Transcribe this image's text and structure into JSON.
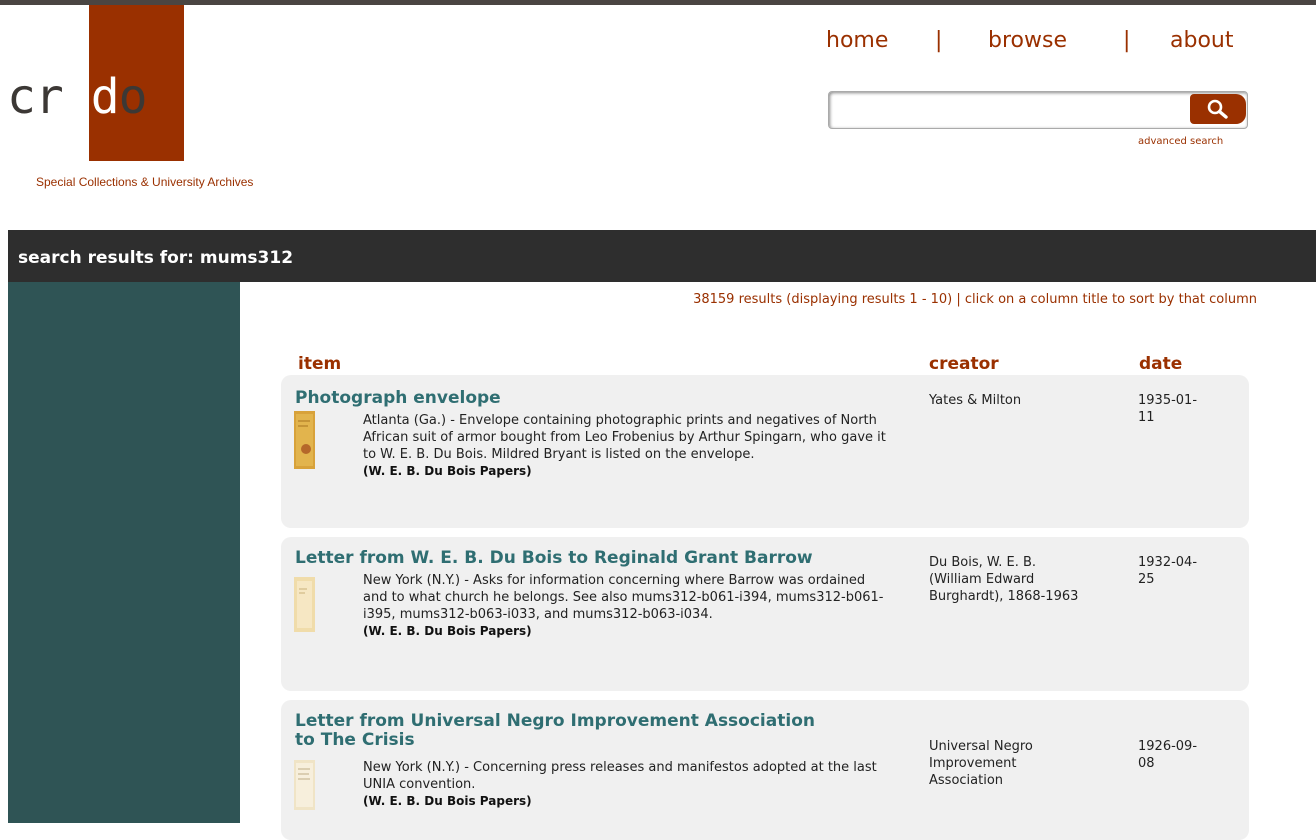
{
  "logo": {
    "part1": "cr",
    "part2": "ed",
    "part3": "o",
    "tagline": "Special Collections & University Archives"
  },
  "nav": {
    "home": "home",
    "separator": "|",
    "browse": "browse",
    "about": "about"
  },
  "search": {
    "value": "",
    "placeholder": "",
    "advanced_label": "advanced search"
  },
  "results": {
    "title": "search results for: mums312",
    "summary": "38159 results (displaying results 1 - 10) | click on a column title to sort by that column",
    "columns": {
      "item": "item",
      "creator": "creator",
      "date": "date"
    },
    "rows": [
      {
        "title": "Photograph envelope",
        "description": "Atlanta (Ga.) - Envelope containing photographic prints and negatives of North African suit of armor bought from Leo Frobenius by Arthur Spingarn, who gave it to W. E. B. Du Bois. Mildred Bryant is listed on the envelope.",
        "collection": "(W. E. B. Du Bois Papers)",
        "creator": "Yates & Milton",
        "date": "1935-01-11",
        "date_display": "1935-01-\n11"
      },
      {
        "title": "Letter from W. E. B. Du Bois to Reginald Grant Barrow",
        "description": "New York (N.Y.) - Asks for information concerning where Barrow was ordained and to what church he belongs. See also mums312-b061-i394, mums312-b061-i395, mums312-b063-i033, and mums312-b063-i034.",
        "collection": "(W. E. B. Du Bois Papers)",
        "creator": "Du Bois, W. E. B. (William Edward Burghardt), 1868-1963",
        "date": "1932-04-25",
        "date_display": "1932-04-\n25"
      },
      {
        "title": "Letter from Universal Negro Improvement Association to The Crisis",
        "description": "New York (N.Y.) - Concerning press releases and manifestos adopted at the last UNIA convention.",
        "collection": "(W. E. B. Du Bois Papers)",
        "creator": "Universal Negro Improvement Association",
        "date": "1926-09-08",
        "date_display": "1926-09-\n08"
      }
    ]
  }
}
